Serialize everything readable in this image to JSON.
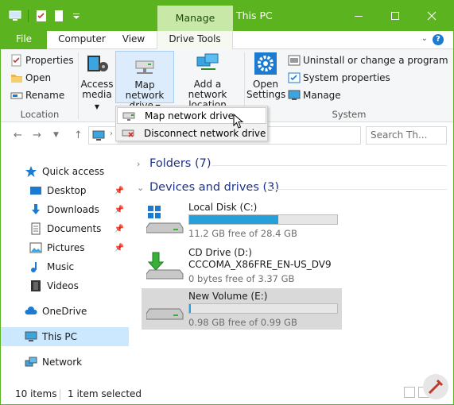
{
  "window": {
    "title": "This PC",
    "contextual_tab": "Manage",
    "accent_color": "#5ab31f"
  },
  "tabs": {
    "file": "File",
    "computer": "Computer",
    "view": "View",
    "drive_tools": "Drive Tools"
  },
  "ribbon": {
    "location": {
      "label": "Location",
      "properties": "Properties",
      "open": "Open",
      "rename": "Rename"
    },
    "network": {
      "access_media_line1": "Access",
      "access_media_line2": "media",
      "map_drive_line1": "Map network",
      "map_drive_line2": "drive",
      "add_location_line1": "Add a network",
      "add_location_line2": "location"
    },
    "system": {
      "label": "System",
      "open_settings_line1": "Open",
      "open_settings_line2": "Settings",
      "uninstall": "Uninstall or change a program",
      "system_properties": "System properties",
      "manage": "Manage"
    }
  },
  "menu": {
    "items": [
      {
        "label": "Map network drive",
        "icon": "map-drive-icon",
        "highlighted": true
      },
      {
        "label": "Disconnect network drive",
        "icon": "disconnect-drive-icon",
        "highlighted": false
      }
    ]
  },
  "search": {
    "placeholder": "Search Th..."
  },
  "nav": {
    "quick_access": "Quick access",
    "desktop": "Desktop",
    "downloads": "Downloads",
    "documents": "Documents",
    "pictures": "Pictures",
    "music": "Music",
    "videos": "Videos",
    "onedrive": "OneDrive",
    "this_pc": "This PC",
    "network": "Network"
  },
  "content": {
    "folders_header": "Folders (7)",
    "devices_header": "Devices and drives (3)",
    "drives": [
      {
        "name": "Local Disk (C:)",
        "free": "11.2 GB free of 28.4 GB",
        "used_fraction": 0.6
      },
      {
        "name": "CD Drive (D:)",
        "label": "CCCOMA_X86FRE_EN-US_DV9",
        "free": "0 bytes free of 3.37 GB"
      },
      {
        "name": "New Volume (E:)",
        "free": "0.98 GB free of 0.99 GB",
        "used_fraction": 0.01
      }
    ]
  },
  "status": {
    "items": "10 items",
    "selected": "1 item selected"
  }
}
